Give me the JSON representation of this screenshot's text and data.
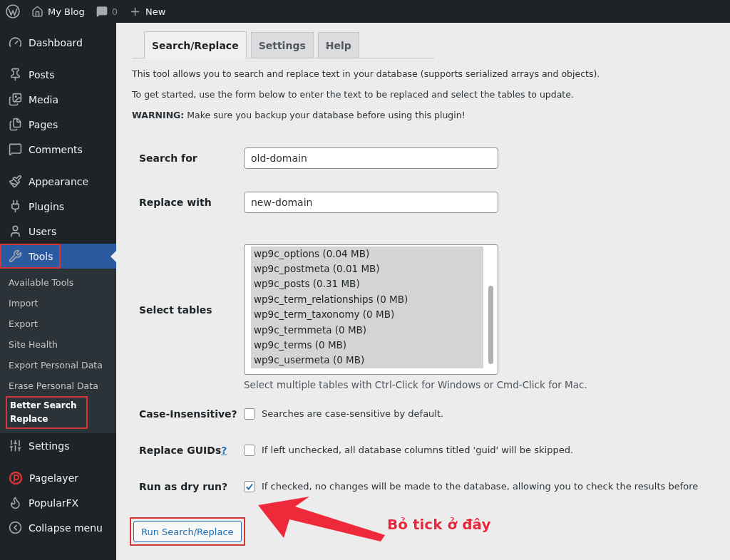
{
  "admin_bar": {
    "site": "My Blog",
    "comments": "0",
    "new": "New"
  },
  "sidebar": {
    "groups": [
      [
        {
          "label": "Dashboard",
          "selected": false,
          "annotated": false
        }
      ],
      [
        {
          "label": "Posts",
          "selected": false,
          "annotated": false
        },
        {
          "label": "Media",
          "selected": false,
          "annotated": false
        },
        {
          "label": "Pages",
          "selected": false,
          "annotated": false
        },
        {
          "label": "Comments",
          "selected": false,
          "annotated": false
        }
      ],
      [
        {
          "label": "Appearance",
          "selected": false,
          "annotated": false
        },
        {
          "label": "Plugins",
          "selected": false,
          "annotated": false
        },
        {
          "label": "Users",
          "selected": false,
          "annotated": false
        },
        {
          "label": "Tools",
          "selected": true,
          "annotated": true,
          "children": [
            {
              "label": "Available Tools",
              "selected": false,
              "annotated": false
            },
            {
              "label": "Import",
              "selected": false,
              "annotated": false
            },
            {
              "label": "Export",
              "selected": false,
              "annotated": false
            },
            {
              "label": "Site Health",
              "selected": false,
              "annotated": false
            },
            {
              "label": "Export Personal Data",
              "selected": false,
              "annotated": false
            },
            {
              "label": "Erase Personal Data",
              "selected": false,
              "annotated": false
            },
            {
              "label": "Better Search Replace",
              "selected": true,
              "annotated": true
            }
          ]
        },
        {
          "label": "Settings",
          "selected": false,
          "annotated": false
        }
      ],
      [
        {
          "label": "Pagelayer",
          "selected": false,
          "annotated": false
        },
        {
          "label": "PopularFX",
          "selected": false,
          "annotated": false
        },
        {
          "label": "Collapse menu",
          "selected": false,
          "annotated": false
        }
      ]
    ]
  },
  "tabs": [
    {
      "label": "Search/Replace",
      "selected": true
    },
    {
      "label": "Settings",
      "selected": false
    },
    {
      "label": "Help",
      "selected": false
    }
  ],
  "intro": [
    "This tool allows you to search and replace text in your database (supports serialized arrays and objects).",
    "To get started, use the form below to enter the text to be replaced and select the tables to update.",
    "**WARNING:** Make sure you backup your database before using this plugin!"
  ],
  "form": [
    {
      "kind": "text",
      "label": "Search for",
      "value": "old-domain"
    },
    {
      "kind": "text",
      "label": "Replace with",
      "value": "new-domain"
    },
    {
      "kind": "tables",
      "label": "Select tables",
      "options": [
        {
          "label": "wp9c_options (0.04 MB)",
          "selected": true
        },
        {
          "label": "wp9c_postmeta (0.01 MB)",
          "selected": true
        },
        {
          "label": "wp9c_posts (0.31 MB)",
          "selected": true
        },
        {
          "label": "wp9c_term_relationships (0 MB)",
          "selected": true
        },
        {
          "label": "wp9c_term_taxonomy (0 MB)",
          "selected": true
        },
        {
          "label": "wp9c_termmeta (0 MB)",
          "selected": true
        },
        {
          "label": "wp9c_terms (0 MB)",
          "selected": true
        },
        {
          "label": "wp9c_usermeta (0 MB)",
          "selected": true
        }
      ],
      "help": "Select multiple tables with Ctrl-Click for Windows or Cmd-Click for Mac."
    },
    {
      "kind": "checkbox",
      "label": "Case-Insensitive?",
      "checked": false,
      "description": "Searches are case-sensitive by default."
    },
    {
      "kind": "checkbox",
      "label": "Replace GUIDs",
      "link": "?",
      "checked": false,
      "description": "If left unchecked, all database columns titled 'guid' will be skipped."
    },
    {
      "kind": "checkbox",
      "label": "Run as dry run?",
      "checked": true,
      "description": "If checked, no changes will be made to the database, allowing you to check the results before"
    }
  ],
  "submit": {
    "label": "Run Search/Replace",
    "annotated": true
  },
  "annotation": {
    "text": "Bỏ tick ở đây"
  }
}
